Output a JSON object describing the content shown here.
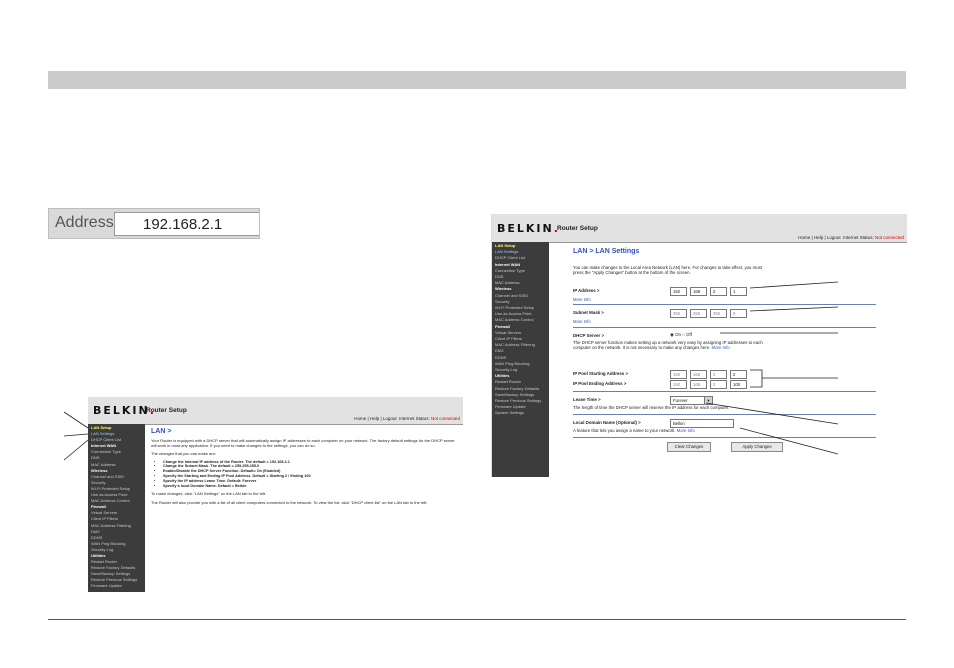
{
  "address_bar": {
    "label": "Address",
    "value": "192.168.2.1"
  },
  "router": {
    "brand": "BELKIN",
    "subtitle": "Router Setup",
    "header_links": "Home | Help | Logout",
    "status_label": "Internet Status:",
    "status_value": "Not connected"
  },
  "nav": [
    {
      "label": "LAN Setup",
      "type": "section-current"
    },
    {
      "label": "LAN Settings",
      "type": "item-highlight"
    },
    {
      "label": "DHCP Client List",
      "type": "item"
    },
    {
      "label": "Internet WAN",
      "type": "section"
    },
    {
      "label": "Connection Type",
      "type": "item"
    },
    {
      "label": "DNS",
      "type": "item"
    },
    {
      "label": "MAC Address",
      "type": "item"
    },
    {
      "label": "Wireless",
      "type": "section"
    },
    {
      "label": "Channel and SSID",
      "type": "item"
    },
    {
      "label": "Security",
      "type": "item"
    },
    {
      "label": "Wi-Fi Protected Setup",
      "type": "item"
    },
    {
      "label": "Use as Access Point",
      "type": "item"
    },
    {
      "label": "MAC Address Control",
      "type": "item"
    },
    {
      "label": "Firewall",
      "type": "section"
    },
    {
      "label": "Virtual Servers",
      "type": "item"
    },
    {
      "label": "Client IP Filters",
      "type": "item"
    },
    {
      "label": "MAC Address Filtering",
      "type": "item"
    },
    {
      "label": "DMZ",
      "type": "item"
    },
    {
      "label": "DDNS",
      "type": "item"
    },
    {
      "label": "WAN Ping Blocking",
      "type": "item"
    },
    {
      "label": "Security Log",
      "type": "item"
    },
    {
      "label": "Utilities",
      "type": "section"
    },
    {
      "label": "Restart Router",
      "type": "item"
    },
    {
      "label": "Restore Factory Defaults",
      "type": "item"
    },
    {
      "label": "Save/Backup Settings",
      "type": "item"
    },
    {
      "label": "Restore Previous Settings",
      "type": "item"
    },
    {
      "label": "Firmware Update",
      "type": "item"
    },
    {
      "label": "System Settings",
      "type": "item"
    }
  ],
  "lan_page": {
    "title": "LAN >",
    "intro": "Your Router is equipped with a DHCP server that will automatically assign IP addresses to each computer on your network. The factory default settings for the DHCP server will work in most any application. If you need to make changes to the settings, you can do so.",
    "changes_intro": "The changes that you can make are:",
    "bullets": [
      "Change the Internal IP address of the Router. The default = 192.168.2.1",
      "Change the Subnet Mask. The default = 255.255.255.0",
      "Enable/Disable the DHCP Server Function. Default= On (Enabled)",
      "Specify the Starting and Ending IP Pool Address. Default = Starting 2 / Ending 100",
      "Specify the IP address Lease Time. Default: Forever",
      "Specify a local Domain Name. Default = Belkin"
    ],
    "instructions": "To make changes, click \"LAN Settings\" on the LAN tab to the left.",
    "client_list_note": "The Router will also provide you with a list of all client computers connected to the network. To view the list, click \"DHCP client list\" on the LAN tab to the left."
  },
  "lan_settings": {
    "title": "LAN > LAN Settings",
    "intro": "You can make changes to the Local Area Network (LAN) here. For changes to take effect, you must press the \"Apply Changes\" button at the bottom of the screen.",
    "ip_label": "IP Address >",
    "ip": [
      "192",
      "168",
      "2",
      "1"
    ],
    "more_info": "More Info",
    "subnet_label": "Subnet Mask >",
    "subnet": [
      "255",
      "255",
      "255",
      "0"
    ],
    "dhcp_label": "DHCP Server >",
    "dhcp_on": "On",
    "dhcp_off": "Off",
    "dhcp_selected": "On",
    "dhcp_desc": "The DHCP server function makes setting up a network very easy by assigning IP addresses to each computer on the network. It is not necessary to make any changes here.",
    "pool_start_label": "IP Pool Starting Address >",
    "pool_start": [
      "192",
      "168",
      "2",
      "2"
    ],
    "pool_end_label": "IP Pool Ending Address >",
    "pool_end": [
      "192",
      "168",
      "2",
      "100"
    ],
    "lease_label": "Lease Time >",
    "lease_value": "Forever",
    "lease_desc": "The length of time the DHCP server will reserve the IP address for each computer.",
    "domain_label": "Local Domain Name (Optional) >",
    "domain_value": "Belkin",
    "domain_desc": "A feature that lets you assign a name to your network.",
    "clear_button": "Clear Changes",
    "apply_button": "Apply Changes"
  }
}
